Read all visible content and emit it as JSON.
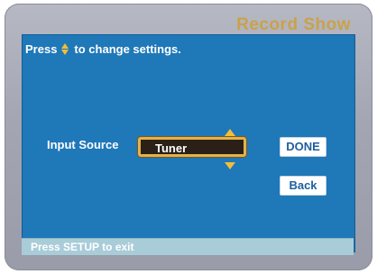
{
  "header": {
    "title": "Record Show"
  },
  "screen": {
    "instruction_before": "Press",
    "instruction_after": "to change settings.",
    "instruction_icon": "up-down-arrows-icon"
  },
  "setting": {
    "label": "Input Source",
    "value": "Tuner",
    "up_icon": "arrow-up-icon",
    "down_icon": "arrow-down-icon"
  },
  "buttons": {
    "done": "DONE",
    "back": "Back"
  },
  "footer": {
    "hint": "Press SETUP to exit"
  },
  "colors": {
    "screen_bg": "#1f78b8",
    "bezel": "#a3a5b2",
    "accent": "#f0bf3a",
    "title": "#c9a24a",
    "footer_bg": "#a9ccd9"
  }
}
